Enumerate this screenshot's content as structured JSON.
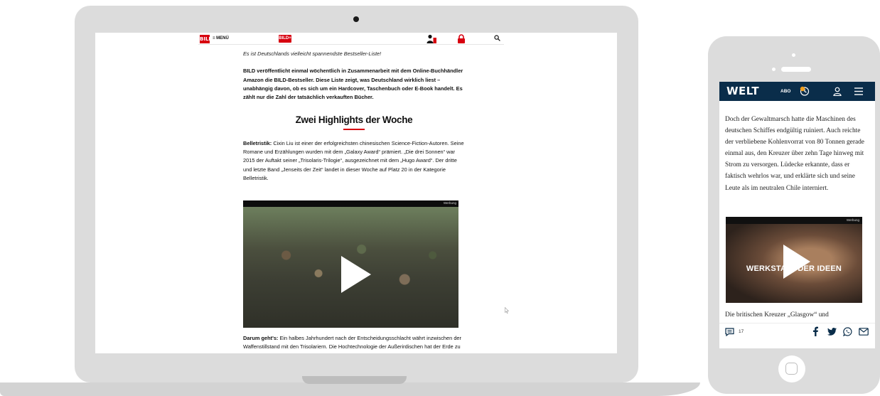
{
  "laptop": {
    "nav": {
      "logo": "BILD",
      "menu_label": "≡ MENÜ",
      "bildplus_logo": "BILD+"
    },
    "article": {
      "intro_italic": "Es ist Deutschlands vielleicht spannendste Bestseller-Liste!",
      "lead": "BILD veröffentlicht einmal wöchentlich in Zusammenarbeit mit dem Online-Buchhändler Amazon die BILD-Bestseller. Diese Liste zeigt, was Deutschland wirklich liest – unabhängig davon, ob es sich um ein Hardcover, Taschenbuch oder E-Book handelt. Es zählt nur die Zahl der tatsächlich verkauften Bücher.",
      "section_heading": "Zwei Highlights der Woche",
      "para_label": "Belletristik:",
      "para_text": " Cixin Liu ist einer der erfolgreichsten chinesischen Science-Fiction-Autoren. Seine Romane und Erzählungen wurden mit dem „Galaxy Award“ prämiert. „Die drei Sonnen“ war 2015 der Auftakt seiner „Trisolaris-Trilogie“, ausgezeichnet mit dem „Hugo Award“. Der dritte und letzte Band „Jenseits der Zeit“ landet in dieser Woche auf Platz 20 in der Kategorie Belletristik.",
      "video_ad_label": "Werbung",
      "after_label": "Darum geht's:",
      "after_text": " Ein halbes Jahrhundert nach der Entscheidungsschlacht währt inzwischen der Waffenstillstand mit den Trisolariern. Die Hochtechnologie der Außerirdischen hat der Erde zu"
    }
  },
  "phone": {
    "nav": {
      "logo": "WELT",
      "abo_label": "ABO"
    },
    "article_text": "Doch der Gewaltmarsch hatte die Maschinen des deutschen Schiffes endgültig ruiniert. Auch reichte der verbliebene Kohlenvorrat von 80 Tonnen gerade einmal aus, den Kreuzer über zehn Tage hinweg mit Strom zu versorgen. Lüdecke erkannte, dass er faktisch wehrlos war, und erklärte sich und seine Leute als im neutralen Chile interniert.",
    "video_ad_label": "Werbung",
    "video_title": "WERKSTATT DER IDEEN",
    "after_text": "Die britischen Kreuzer „Glasgow“ und",
    "comment_count": "17"
  },
  "colors": {
    "bild_red": "#d7000f",
    "welt_navy": "#0a2d4a",
    "device_gray": "#dcdcdc"
  },
  "icons": [
    "menu-icon",
    "user-icon",
    "lock-icon",
    "search-icon",
    "play-icon",
    "notification-icon",
    "hamburger-icon",
    "comment-icon",
    "facebook-icon",
    "twitter-icon",
    "whatsapp-icon",
    "mail-icon",
    "cursor-icon"
  ]
}
